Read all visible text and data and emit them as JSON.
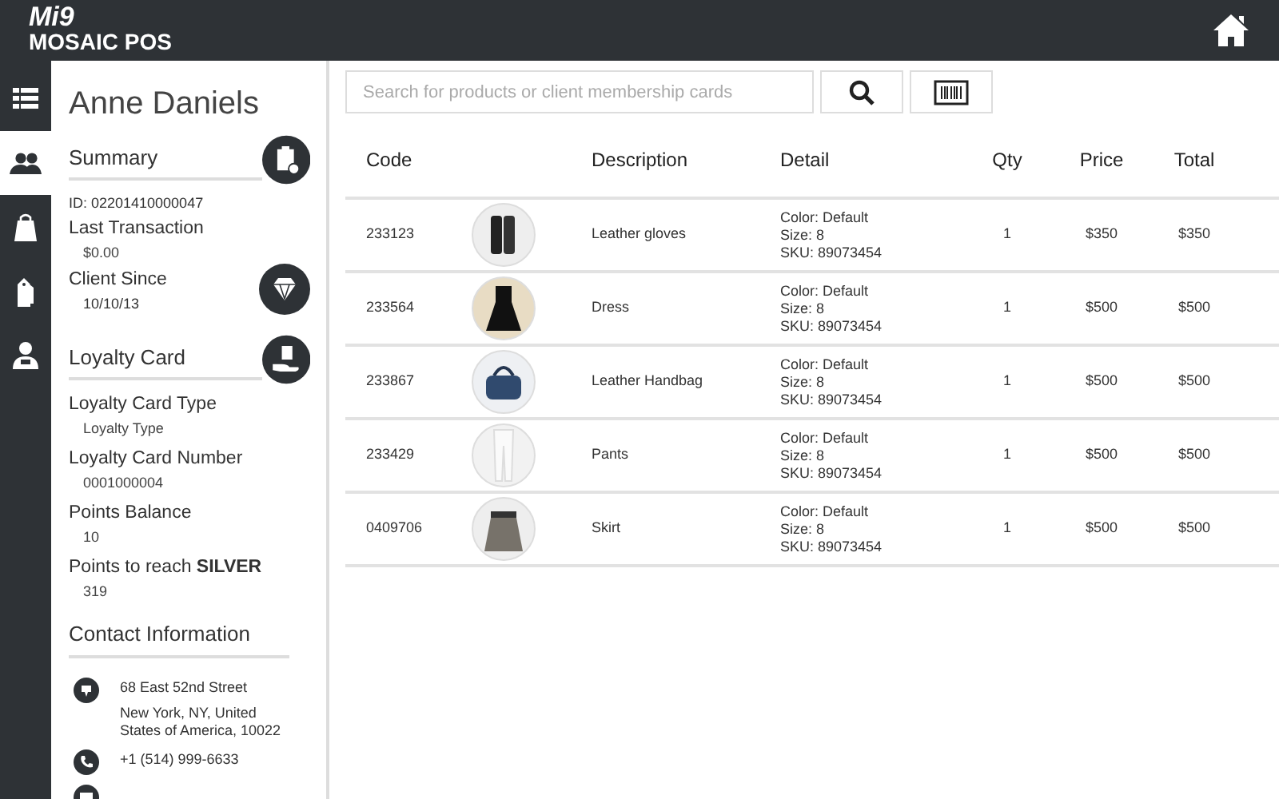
{
  "header": {
    "logo_top": "Mi9",
    "logo_bottom": "MOSAIC POS"
  },
  "nav": [
    {
      "kind": "menu",
      "selected": false
    },
    {
      "kind": "clients",
      "selected": true
    },
    {
      "kind": "bag",
      "selected": false
    },
    {
      "kind": "tags",
      "selected": false
    },
    {
      "kind": "agent",
      "selected": false
    }
  ],
  "client": {
    "name": "Anne Daniels",
    "summary": {
      "title": "Summary",
      "id": "ID: 02201410000047",
      "fields": [
        {
          "label": "Last Transaction",
          "value": "$0.00"
        },
        {
          "label": "Client Since",
          "value": "10/10/13"
        }
      ]
    },
    "loyalty": {
      "title": "Loyalty Card",
      "fields": [
        {
          "label": "Loyalty Card Type",
          "value": "Loyalty Type"
        },
        {
          "label": "Loyalty Card Number",
          "value": "0001000004"
        },
        {
          "label": "Points Balance",
          "value": "10"
        },
        {
          "label": "Points to reach **SILVER**",
          "value": "319"
        }
      ]
    },
    "contact": {
      "title": "Contact Information",
      "entries": [
        {
          "kind": "address",
          "lines": [
            "68 East 52nd Street",
            "New York, NY, United States of America, 10022"
          ]
        },
        {
          "kind": "phone",
          "lines": [
            "+1 (514) 999-6633"
          ]
        },
        {
          "kind": "email"
        }
      ]
    }
  },
  "search": {
    "placeholder": "Search for products or client membership cards"
  },
  "table": {
    "columns": [
      "Code",
      "",
      "Description",
      "Detail",
      "Qty",
      "Price",
      "Total"
    ],
    "rows": [
      {
        "code": "233123",
        "kind": "gloves",
        "description": "Leather gloves",
        "detail": [
          "Color: Default",
          "Size: 8",
          "SKU: 89073454"
        ],
        "qty": "1",
        "price": "$350",
        "total": "$350"
      },
      {
        "code": "233564",
        "kind": "dress",
        "description": "Dress",
        "detail": [
          "Color: Default",
          "Size: 8",
          "SKU: 89073454"
        ],
        "qty": "1",
        "price": "$500",
        "total": "$500"
      },
      {
        "code": "233867",
        "kind": "handbag",
        "description": "Leather Handbag",
        "detail": [
          "Color: Default",
          "Size: 8",
          "SKU: 89073454"
        ],
        "qty": "1",
        "price": "$500",
        "total": "$500"
      },
      {
        "code": "233429",
        "kind": "pants",
        "description": "Pants",
        "detail": [
          "Color: Default",
          "Size: 8",
          "SKU: 89073454"
        ],
        "qty": "1",
        "price": "$500",
        "total": "$500"
      },
      {
        "code": "0409706",
        "kind": "skirt",
        "description": "Skirt",
        "detail": [
          "Color: Default",
          "Size: 8",
          "SKU: 89073454"
        ],
        "qty": "1",
        "price": "$500",
        "total": "$500"
      }
    ]
  }
}
